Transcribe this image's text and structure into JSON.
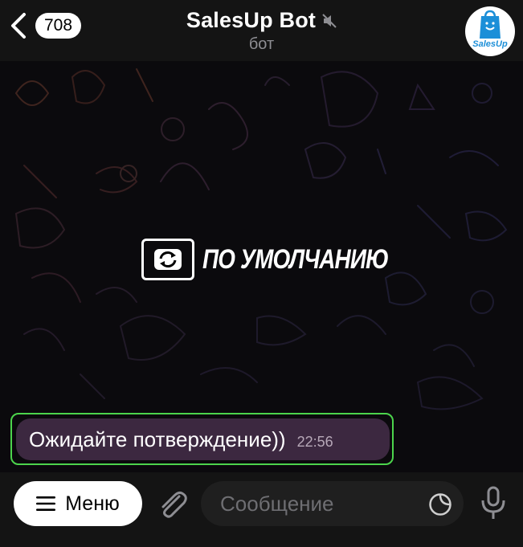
{
  "header": {
    "back_count": "708",
    "title": "SalesUp Bot",
    "subtitle": "бот",
    "avatar_text": "SalesUp",
    "icons": [
      "back-chevron-icon",
      "muted-speaker-icon",
      "shopping-bag-icon"
    ]
  },
  "chat": {
    "logo_text": "ПО УМОЛЧАНИЮ",
    "message": {
      "text": "Ожидайте потверждение))",
      "time": "22:56"
    }
  },
  "composer": {
    "menu_label": "Меню",
    "placeholder": "Сообщение",
    "icons": [
      "hamburger-icon",
      "paperclip-icon",
      "sticker-icon",
      "microphone-icon"
    ]
  },
  "colors": {
    "bubble": "#3c2840",
    "highlight": "#4cd44c",
    "header": "#141414",
    "accent": "#1c8fd8"
  }
}
